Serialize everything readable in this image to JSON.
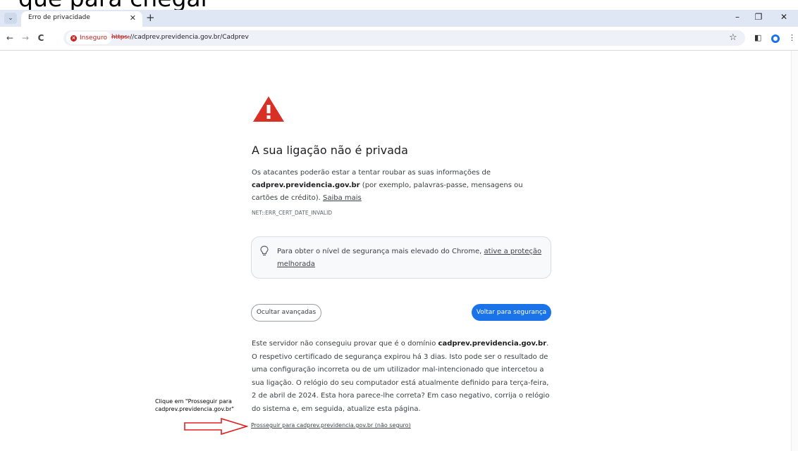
{
  "banner": {
    "text": "que para chegar"
  },
  "browser": {
    "tab_title": "Erro de privacidade",
    "tab_close": "✕",
    "new_tab": "+",
    "tab_search": "⌄",
    "win_min": "–",
    "win_max": "❐",
    "win_close": "✕",
    "back": "←",
    "forward": "→",
    "reload": "C",
    "insecure_label": "Inseguro",
    "url_scheme": "https:",
    "url_rest": "//cadprev.previdencia.gov.br/Cadprev",
    "star": "☆",
    "menu": "⋮",
    "sidepanel": "◧"
  },
  "page": {
    "heading": "A sua ligação não é privada",
    "main_part1": "Os atacantes poderão estar a tentar roubar as suas informações de ",
    "main_domain": "cadprev.previdencia.gov.br",
    "main_part2": " (por exemplo, palavras-passe, mensagens ou cartões de crédito). ",
    "learn_more": "Saiba mais",
    "error_code": "NET::ERR_CERT_DATE_INVALID",
    "tip_part1": "Para obter o nível de segurança mais elevado do Chrome, ",
    "tip_link": "ative a proteção melhorada",
    "hide_advanced": "Ocultar avançadas",
    "back_to_safety": "Voltar para segurança",
    "details_part1": "Este servidor não conseguiu provar que é o domínio ",
    "details_domain": "cadprev.previdencia.gov.br",
    "details_part2": ". O respetivo certificado de segurança expirou há 3 dias. Isto pode ser o resultado de uma configuração incorreta ou de um utilizador mal-intencionado que intercetou a sua ligação. O relógio do seu computador está atualmente definido para terça-feira, 2 de abril de 2024. Esta hora parece-lhe correta? Em caso negativo, corrija o relógio do sistema e, em seguida, atualize esta página.",
    "proceed_link": "Prosseguir para cadprev.previdencia.gov.br (não seguro)"
  },
  "annotation": {
    "line1": "Clique em \"Prosseguir para",
    "line2": "cadprev.previdencia.gov.br\""
  },
  "colors": {
    "accent_blue": "#1a73e8",
    "warning_red": "#d93025",
    "annotation_arrow": "#e02020"
  },
  "icons": {
    "warning": "warning-triangle-icon",
    "tip": "lightbulb-icon",
    "insecure": "insecure-icon"
  }
}
